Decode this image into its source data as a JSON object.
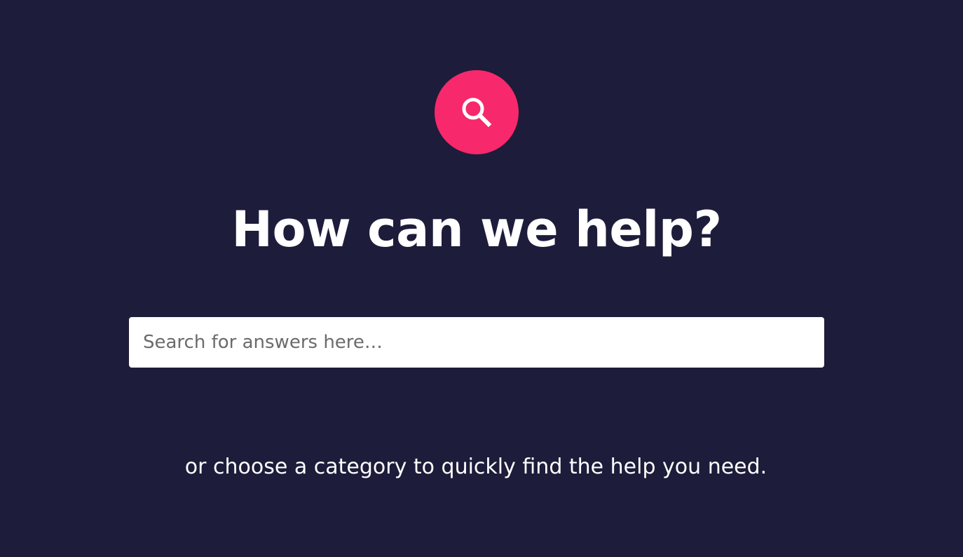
{
  "hero": {
    "icon": "search-icon",
    "accent_color": "#f7286b",
    "background_color": "#1d1c3a",
    "title": "How can we help?",
    "search": {
      "value": "",
      "placeholder": "Search for answers here…"
    },
    "subtitle": "or choose a category to quickly find the help you need."
  }
}
